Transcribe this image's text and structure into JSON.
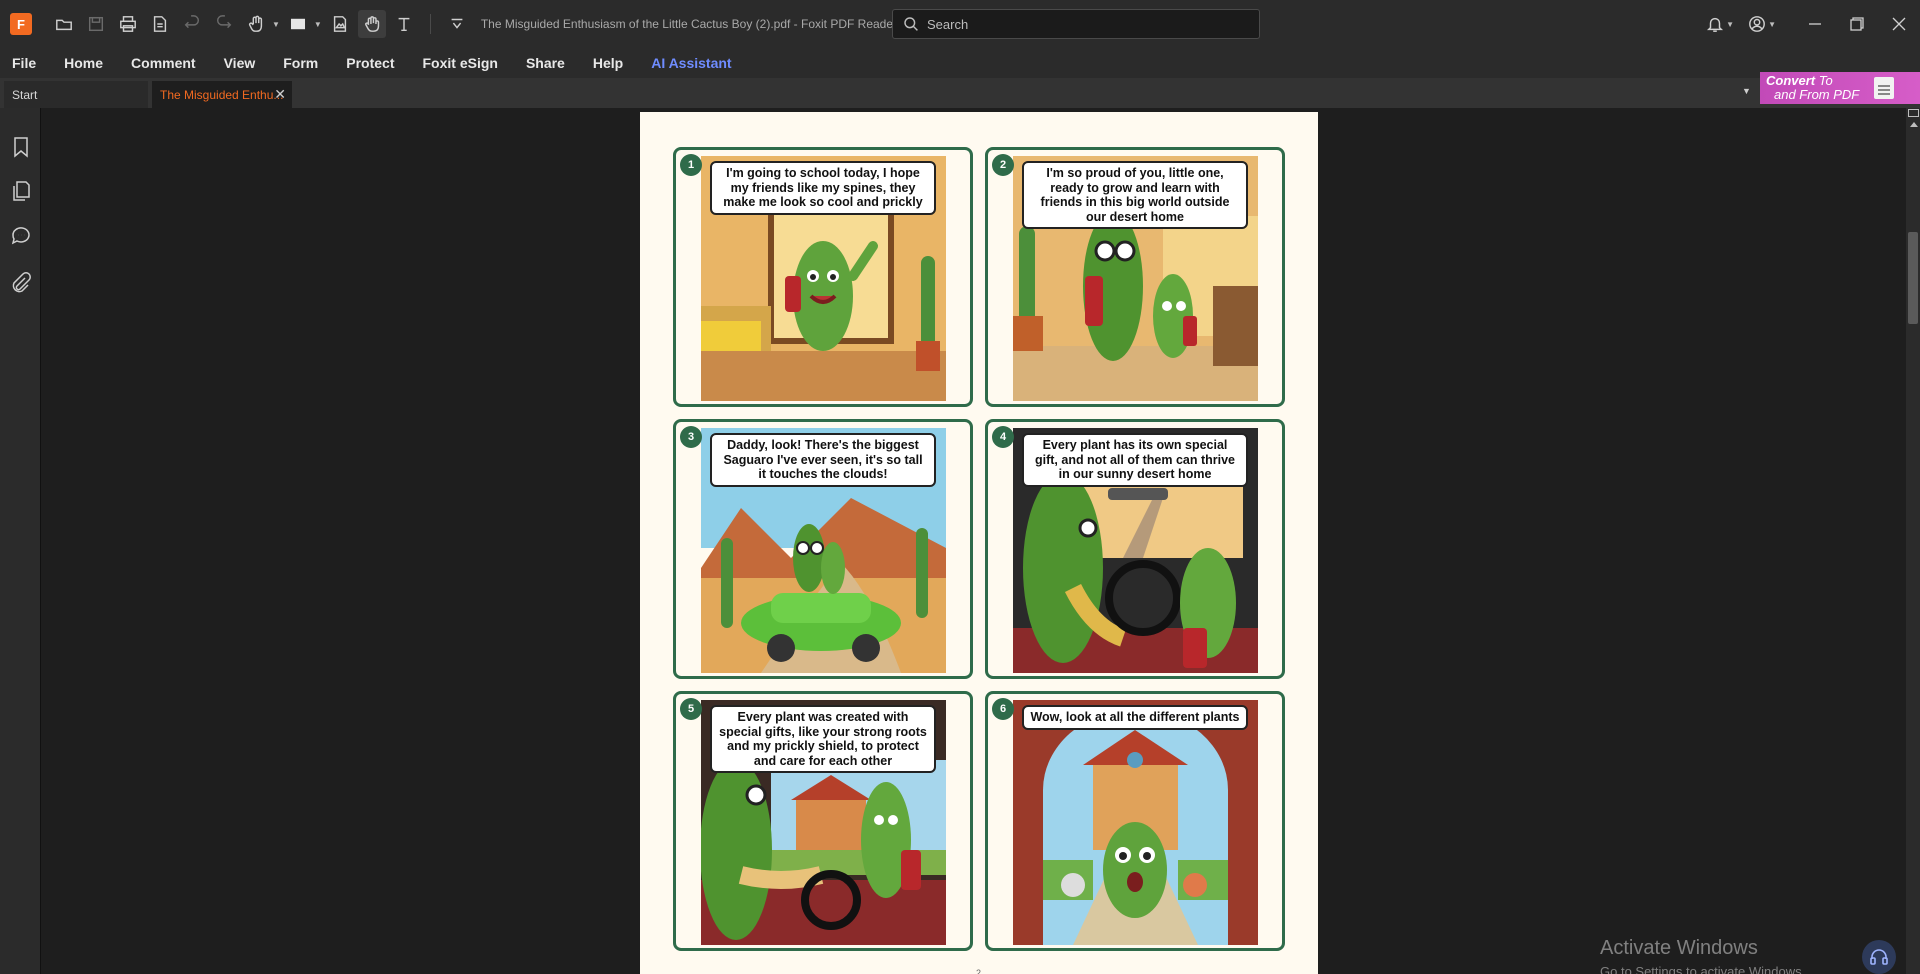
{
  "window": {
    "title": "The Misguided Enthusiasm of the Little Cactus Boy (2).pdf - Foxit PDF Reader",
    "search_placeholder": "Search",
    "icons": [
      "foxit-logo",
      "open-folder-icon",
      "save-icon",
      "print-icon",
      "properties-icon",
      "undo-icon",
      "redo-icon",
      "select-hand-icon",
      "rectangle-icon",
      "insert-image-icon",
      "hand-icon",
      "text-select-icon",
      "quick-access-dropdown-icon",
      "bell-icon",
      "account-icon",
      "minimize-icon",
      "restore-icon",
      "close-icon"
    ]
  },
  "menu": {
    "items": [
      "File",
      "Home",
      "Comment",
      "View",
      "Form",
      "Protect",
      "Foxit eSign",
      "Share",
      "Help",
      "AI Assistant"
    ]
  },
  "tabs": [
    {
      "label": "Start",
      "active": false
    },
    {
      "label": "The Misguided Enthu...",
      "active": true
    }
  ],
  "convert": {
    "line1_bold": "Convert",
    "line1_rest": " To",
    "line2": "and From PDF"
  },
  "sidebar": {
    "icons": [
      "bookmark-icon",
      "pages-icon",
      "comments-icon",
      "attachment-icon"
    ]
  },
  "page": {
    "number_label": "2",
    "panels": [
      {
        "num": "1",
        "text": "I'm going to school today, I hope my friends like my spines, they make me look so cool and prickly"
      },
      {
        "num": "2",
        "text": "I'm so proud of you, little one, ready to grow and learn with friends in this big world outside our desert home"
      },
      {
        "num": "3",
        "text": "Daddy, look! There's the biggest Saguaro I've ever seen, it's so tall it touches the clouds!"
      },
      {
        "num": "4",
        "text": "Every plant has its own special gift, and not all of them can thrive in our sunny desert home"
      },
      {
        "num": "5",
        "text": "Every plant was created with special gifts, like your strong roots and my prickly shield, to protect and care for each other"
      },
      {
        "num": "6",
        "text": "Wow, look at all the different plants"
      }
    ]
  },
  "watermark": {
    "line1": "Activate Windows",
    "line2": "Go to Settings to activate Windows."
  },
  "colors": {
    "accent": "#f26a21",
    "ai": "#6f8cff",
    "panel_border": "#2f6b4a",
    "page_bg": "#fffaf0"
  }
}
